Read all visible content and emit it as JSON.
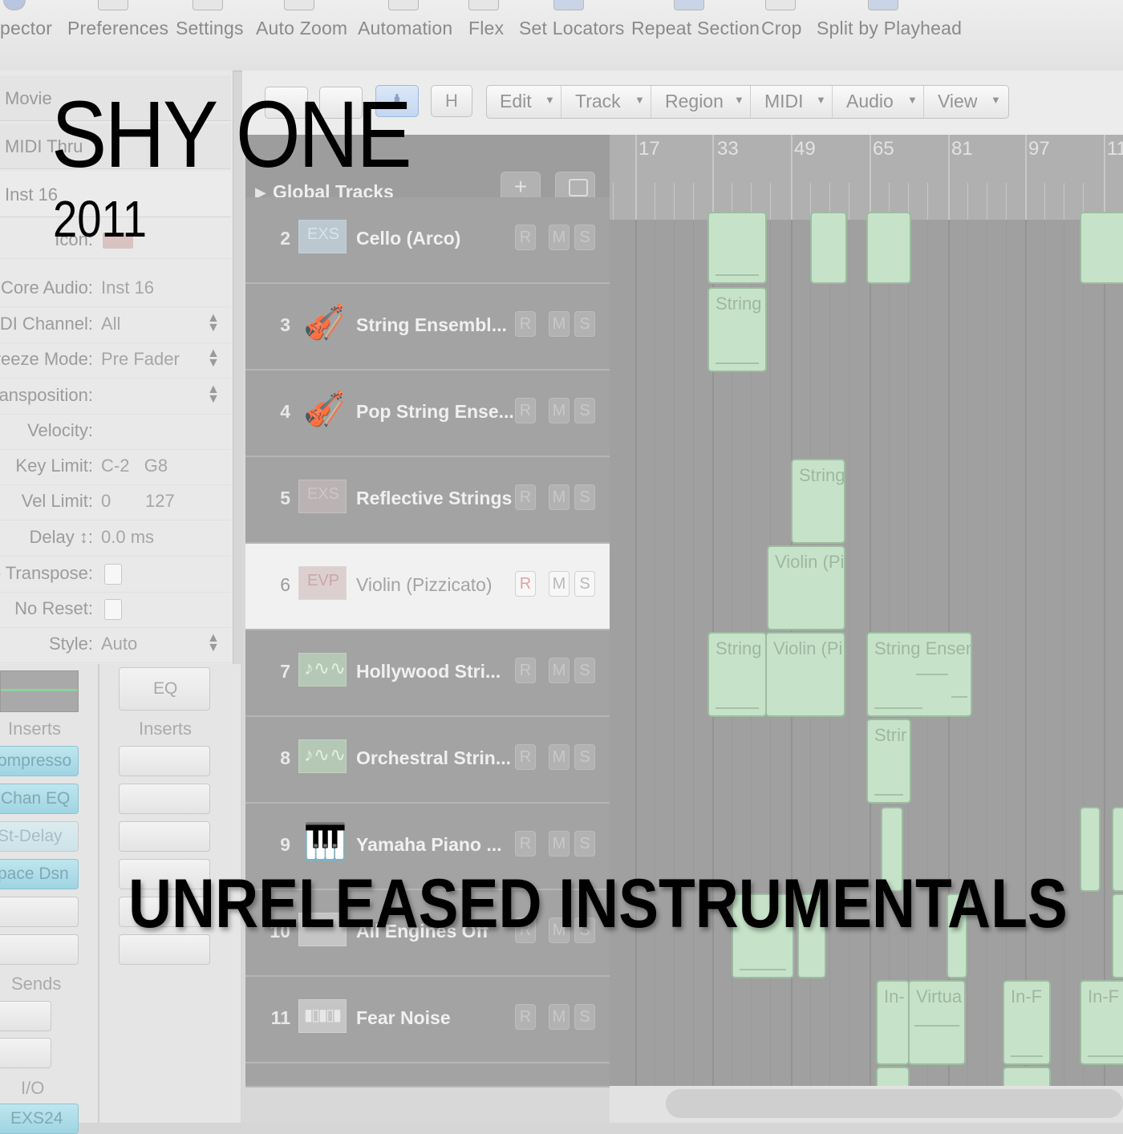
{
  "toolbar": {
    "items": [
      "pector",
      "Preferences",
      "Settings",
      "Auto Zoom",
      "Automation",
      "Flex",
      "Set Locators",
      "Repeat Section",
      "Crop",
      "Split by Playhead"
    ]
  },
  "inspector": {
    "header": "Movie",
    "midi_thru": "MIDI Thru",
    "inst": "Inst 16",
    "icon_label": "Icon:",
    "rows": [
      {
        "key": "Core Audio:",
        "value": "Inst 16"
      },
      {
        "key": "MIDI Channel:",
        "value": "All"
      },
      {
        "key": "Freeze Mode:",
        "value": "Pre Fader"
      },
      {
        "key": "ransposition:",
        "value": ""
      },
      {
        "key": "Velocity:",
        "value": ""
      },
      {
        "key": "Key Limit:",
        "value": "C-2   G8"
      },
      {
        "key": "Vel Limit:",
        "value": "0       127"
      },
      {
        "key": "Delay ↕:",
        "value": "0.0 ms"
      },
      {
        "key": "o Transpose:",
        "value": ""
      },
      {
        "key": "No Reset:",
        "value": ""
      },
      {
        "key": "Style:",
        "value": "Auto"
      }
    ]
  },
  "strips": {
    "eq_label": "EQ",
    "inserts_label": "Inserts",
    "sends_label": "Sends",
    "io_label": "I/O",
    "inserts": [
      "ompresso",
      "Chan EQ",
      "St-Delay",
      "pace Dsn"
    ],
    "io_slot": "EXS24"
  },
  "arrange": {
    "hide_button": "H",
    "menus": [
      "Edit",
      "Track",
      "Region",
      "MIDI",
      "Audio",
      "View"
    ],
    "global_tracks": "Global Tracks",
    "ruler": [
      "17",
      "33",
      "49",
      "65",
      "81",
      "97",
      "11"
    ],
    "rms": [
      "R",
      "M",
      "S"
    ],
    "tracks": [
      {
        "num": "2",
        "icon": "exs-icon",
        "name": "Cello (Arco)"
      },
      {
        "num": "3",
        "icon": "violin-icon",
        "name": "String Ensembl..."
      },
      {
        "num": "4",
        "icon": "violin-icon",
        "name": "Pop String Ense..."
      },
      {
        "num": "5",
        "icon": "exs-icon",
        "name": "Reflective Strings"
      },
      {
        "num": "6",
        "icon": "evp-icon",
        "name": "Violin (Pizzicato)"
      },
      {
        "num": "7",
        "icon": "audio-wave-icon",
        "name": "Hollywood Stri..."
      },
      {
        "num": "8",
        "icon": "audio-wave-icon",
        "name": "Orchestral Strin..."
      },
      {
        "num": "9",
        "icon": "piano-icon",
        "name": "Yamaha Piano ..."
      },
      {
        "num": "10",
        "icon": "synth-icon",
        "name": "All Engines Off"
      },
      {
        "num": "11",
        "icon": "synth-icon",
        "name": "Fear Noise"
      }
    ],
    "regions": [
      "String",
      "String",
      "String",
      "Violin (Pi",
      "String",
      "Violin (Pi",
      "String Ensen",
      "Strir",
      "In-",
      "Virtua",
      "In-F",
      "In-F"
    ]
  },
  "overlay": {
    "title": "SHY ONE",
    "year": "2011",
    "subtitle": "UNRELEASED INSTRUMENTALS"
  }
}
